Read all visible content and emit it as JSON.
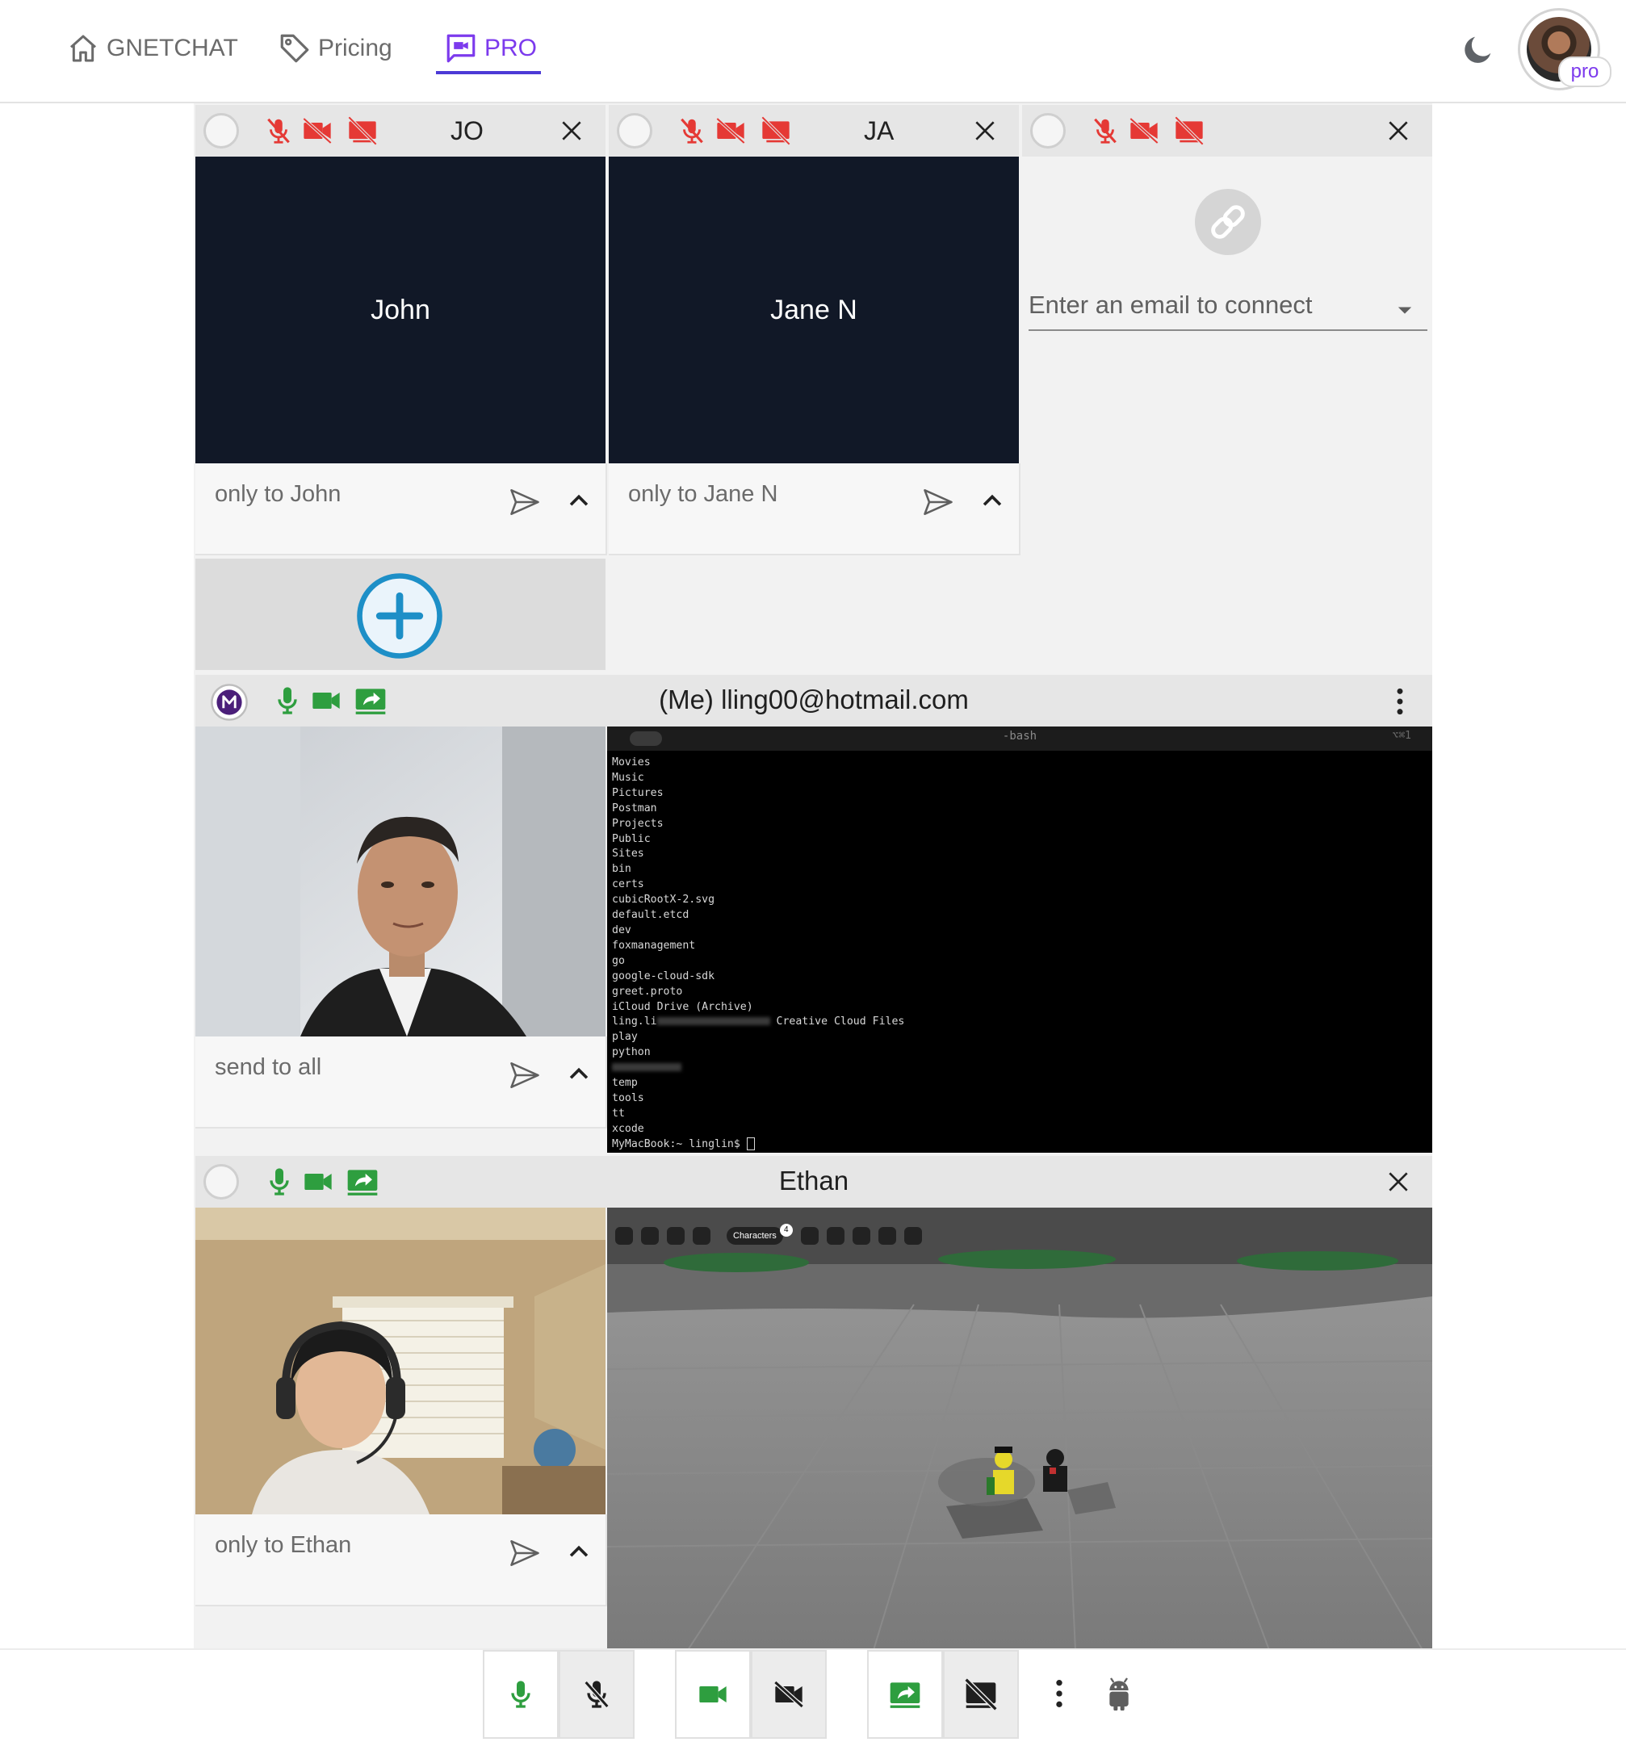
{
  "nav": {
    "brand": "GNETCHAT",
    "pricing": "Pricing",
    "pro": "PRO",
    "avatar_badge": "pro"
  },
  "peers": [
    {
      "initials": "JO",
      "display_name": "John",
      "message_placeholder": "only to John"
    },
    {
      "initials": "JA",
      "display_name": "Jane N",
      "message_placeholder": "only to Jane N"
    }
  ],
  "connect": {
    "placeholder": "Enter an email to connect"
  },
  "me": {
    "title": "(Me) lling00@hotmail.com",
    "message_placeholder": "send to all",
    "terminal": {
      "title": "-bash",
      "shortcut": "⌥⌘1",
      "lines": [
        "Movies",
        "Music",
        "Pictures",
        "Postman",
        "Projects",
        "Public",
        "Sites",
        "bin",
        "certs",
        "cubicRootX-2.svg",
        "default.etcd",
        "dev",
        "foxmanagement",
        "go",
        "google-cloud-sdk",
        "greet.proto",
        "iCloud Drive (Archive)",
        "ling.li",
        "play",
        "python",
        "",
        "temp",
        "tools",
        "tt",
        "xcode"
      ],
      "ling_suffix": "Creative Cloud Files",
      "prompt": "MyMacBook:~ linglin$ "
    }
  },
  "ethan": {
    "title": "Ethan",
    "message_placeholder": "only to Ethan",
    "game_toolbar_label": "Characters",
    "game_badge": "4"
  },
  "colors": {
    "accent_purple": "#7c3aed",
    "muted_red": "#e53935",
    "active_green": "#2e9e3f",
    "add_blue": "#1d8fc7",
    "video_dark": "#111827"
  },
  "icons": {
    "nav": [
      "home-icon",
      "tag-icon",
      "video-chat-icon"
    ],
    "header": [
      "moon-icon"
    ],
    "tile": [
      "mic-off-icon",
      "camera-off-icon",
      "screen-share-off-icon",
      "close-icon",
      "send-icon",
      "chevron-up-icon",
      "link-icon",
      "plus-circle-icon",
      "dropdown-arrow-icon"
    ],
    "row": [
      "mic-icon",
      "camera-icon",
      "screen-share-icon",
      "more-vertical-icon"
    ],
    "toolbar": [
      "mic-icon",
      "mic-off-icon",
      "camera-icon",
      "camera-off-icon",
      "screen-share-icon",
      "screen-share-off-icon",
      "more-vertical-icon",
      "android-icon"
    ]
  }
}
